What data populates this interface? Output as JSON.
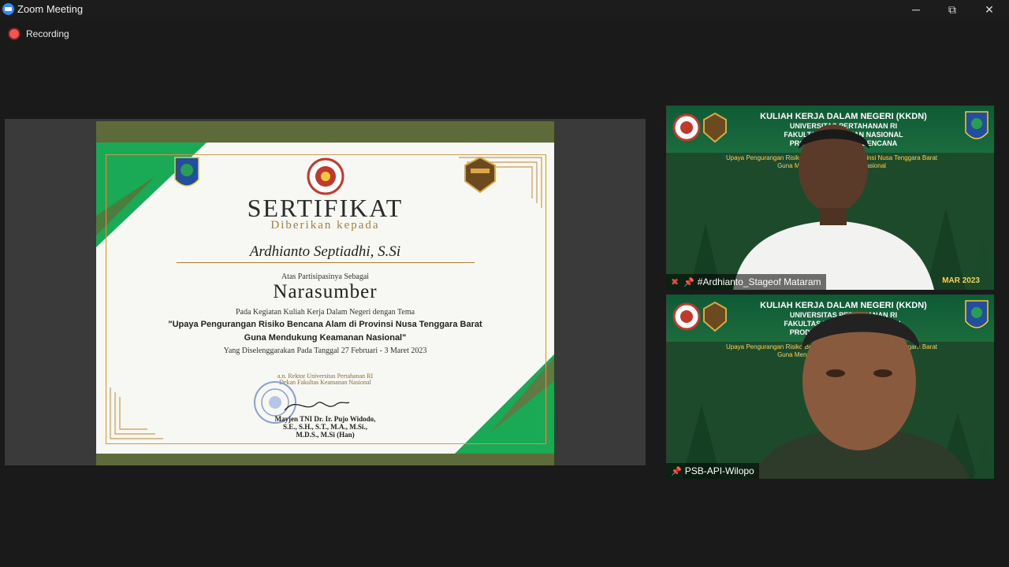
{
  "window": {
    "title": "Zoom Meeting",
    "minimize": "─",
    "restore": "⧉",
    "close": "✕"
  },
  "recording": {
    "label": "Recording"
  },
  "certificate": {
    "title": "SERTIFIKAT",
    "subtitle": "Diberikan kepada",
    "recipient": "Ardhianto Septiadhi, S.Si",
    "participation": "Atas Partisipasinya Sebagai",
    "role": "Narasumber",
    "activity": "Pada Kegiatan Kuliah Kerja Dalam Negeri dengan Tema",
    "theme_line1": "\"Upaya Pengurangan Risiko Bencana Alam di Provinsi Nusa Tenggara Barat",
    "theme_line2": "Guna Mendukung Keamanan Nasional\"",
    "date": "Yang Diselenggarakan Pada Tanggal 27 Februari - 3 Maret 2023",
    "sign_line1": "a.n. Rektor Universitas Pertahanan RI",
    "sign_line2": "Dekan Fakultas Keamanan Nasional",
    "signer_line1": "Mayjen TNI Dr. Ir. Pujo Widodo,",
    "signer_line2": "S.E., S.H., S.T., M.A., M.Si.,",
    "signer_line3": "M.D.S., M.Si (Han)"
  },
  "participants": [
    {
      "name": "#Ardhianto_Stageof Mataram",
      "muted": true,
      "banner_title1": "KULIAH KERJA DALAM NEGERI (KKDN)",
      "banner_title2": "UNIVERSITAS PERTAHANAN RI",
      "banner_title3": "FAKULTAS KEAMANAN NASIONAL",
      "banner_title4": "PRODI MANAJEMEN BENCANA",
      "banner_sub1": "Upaya Pengurangan Risiko Bencana Alam di Provinsi Nusa Tenggara Barat",
      "banner_sub2": "Guna Mendukung Keamanan Nasional",
      "corner_text": "MAR 2023"
    },
    {
      "name": "PSB-API-Wilopo",
      "muted": false,
      "banner_title1": "KULIAH KERJA DALAM NEGERI (KKDN)",
      "banner_title2": "UNIVERSITAS PERTAHANAN RI",
      "banner_title3": "FAKULTAS KEAMANAN NASIONAL",
      "banner_title4": "PRODI MANAJEMEN BENCANA",
      "banner_sub1": "Upaya Pengurangan Risiko Bencana Alam di Provinsi Nusa Tenggara Barat",
      "banner_sub2": "Guna Mendukung Keamanan Nasional"
    }
  ],
  "colors": {
    "accent": "#2d8cff",
    "recording": "#f6544f",
    "cert_green": "#1aa955",
    "cert_olive": "#5c6b39",
    "cert_gold": "#c79a56"
  }
}
